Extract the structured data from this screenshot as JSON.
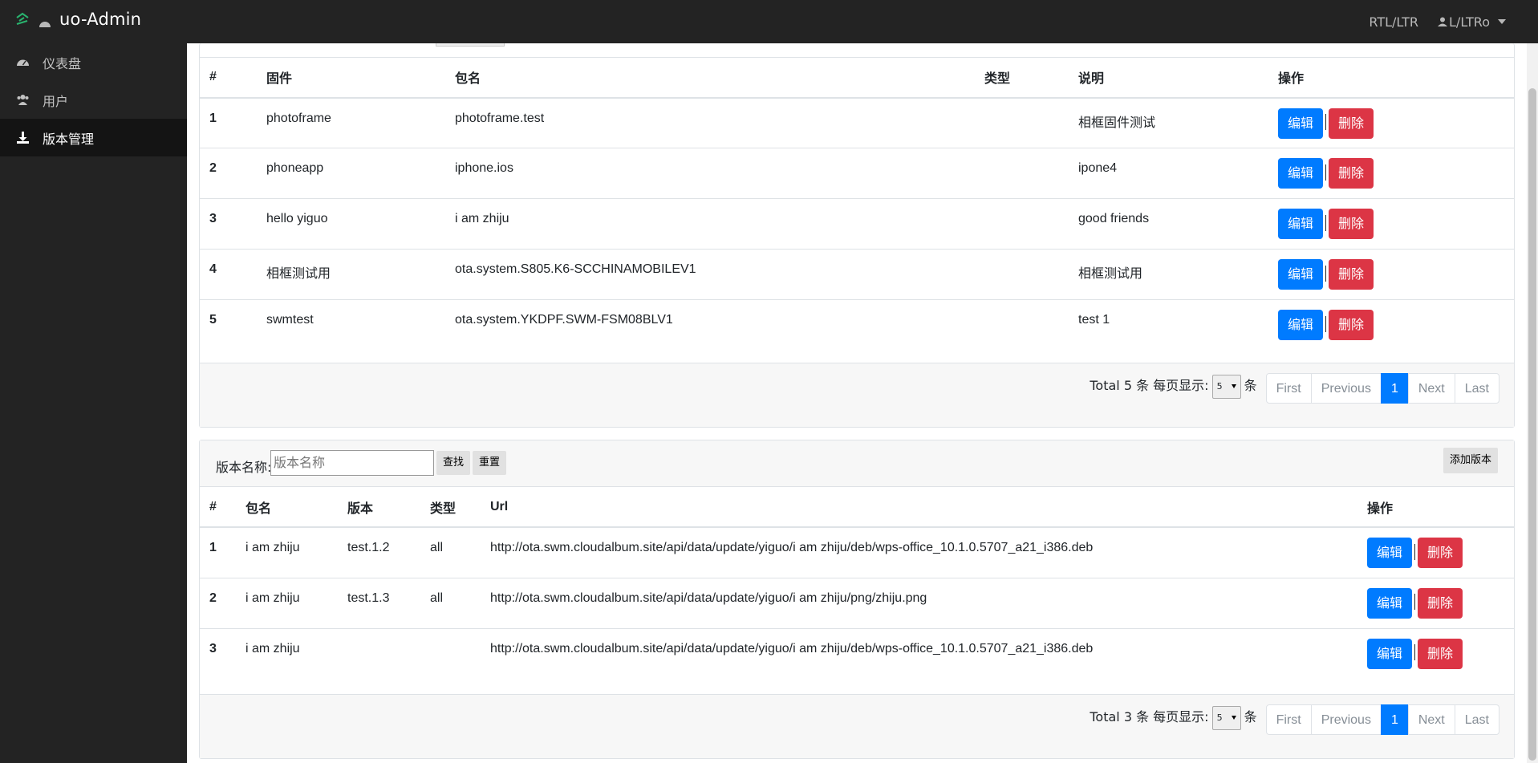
{
  "navbar": {
    "brand": "uo-Admin",
    "rtl_ltr": "RTL/LTR",
    "user_menu": "L/LTRo"
  },
  "sidebar": {
    "items": [
      {
        "label": "仪表盘",
        "icon": "dashboard-icon"
      },
      {
        "label": "用户",
        "icon": "users-icon"
      },
      {
        "label": "版本管理",
        "icon": "download-icon"
      }
    ]
  },
  "firmware_table": {
    "headers": [
      "#",
      "固件",
      "包名",
      "类型",
      "说明",
      "操作"
    ],
    "rows": [
      {
        "id": "1",
        "firmware": "photoframe",
        "package": "photoframe.test",
        "type": "",
        "desc": "相框固件测试"
      },
      {
        "id": "2",
        "firmware": "phoneapp",
        "package": "iphone.ios",
        "type": "",
        "desc": "ipone4"
      },
      {
        "id": "3",
        "firmware": "hello yiguo",
        "package": "i am zhiju",
        "type": "",
        "desc": "good friends"
      },
      {
        "id": "4",
        "firmware": "相框测试用",
        "package": "ota.system.S805.K6-SCCHINAMOBILEV1",
        "type": "",
        "desc": "相框测试用"
      },
      {
        "id": "5",
        "firmware": "swmtest",
        "package": "ota.system.YKDPF.SWM-FSM08BLV1",
        "type": "",
        "desc": "test 1"
      }
    ],
    "edit_label": "编辑",
    "delete_label": "删除",
    "pager": {
      "total": "Total 5 条 每页显示:",
      "per_page": "5",
      "suffix": "条"
    }
  },
  "pagination": {
    "first": "First",
    "previous": "Previous",
    "current": "1",
    "next": "Next",
    "last": "Last"
  },
  "version_filter": {
    "label": "版本名称:",
    "placeholder": "版本名称",
    "search": "查找",
    "reset": "重置",
    "add": "添加版本"
  },
  "version_table": {
    "headers": [
      "#",
      "包名",
      "版本",
      "类型",
      "Url",
      "操作"
    ],
    "rows": [
      {
        "id": "1",
        "package": "i am zhiju",
        "version": "test.1.2",
        "type": "all",
        "url": "http://ota.swm.cloudalbum.site/api/data/update/yiguo/i am zhiju/deb/wps-office_10.1.0.5707_a21_i386.deb"
      },
      {
        "id": "2",
        "package": "i am zhiju",
        "version": "test.1.3",
        "type": "all",
        "url": "http://ota.swm.cloudalbum.site/api/data/update/yiguo/i am zhiju/png/zhiju.png"
      },
      {
        "id": "3",
        "package": "i am zhiju",
        "version": "",
        "type": "",
        "url": "http://ota.swm.cloudalbum.site/api/data/update/yiguo/i am zhiju/deb/wps-office_10.1.0.5707_a21_i386.deb"
      }
    ],
    "pager": {
      "total": "Total 3 条 每页显示:",
      "per_page": "5",
      "suffix": "条"
    }
  }
}
